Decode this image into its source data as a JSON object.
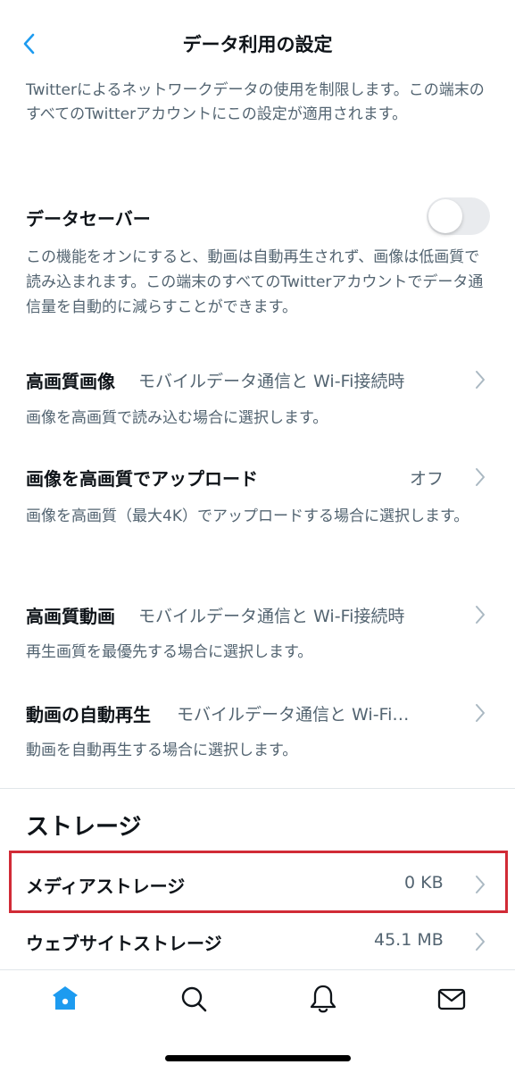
{
  "header": {
    "title": "データ利用の設定",
    "back_icon": "chevron-left-icon"
  },
  "intro": "Twitterによるネットワークデータの使用を制限します。この端末のすべてのTwitterアカウントにこの設定が適用されます。",
  "data_saver": {
    "label": "データセーバー",
    "enabled": false,
    "description": "この機能をオンにすると、動画は自動再生されず、画像は低画質で読み込まれます。この端末のすべてのTwitterアカウントでデータ通信量を自動的に減らすことができます。"
  },
  "settings": [
    {
      "label": "高画質画像",
      "value": "モバイルデータ通信と Wi-Fi接続時",
      "description": "画像を高画質で読み込む場合に選択します。"
    },
    {
      "label": "画像を高画質でアップロード",
      "value": "オフ",
      "description": "画像を高画質（最大4K）でアップロードする場合に選択します。"
    },
    {
      "label": "高画質動画",
      "value": "モバイルデータ通信と Wi-Fi接続時",
      "description": "再生画質を最優先する場合に選択します。"
    },
    {
      "label": "動画の自動再生",
      "value": "モバイルデータ通信と Wi-Fi…",
      "description": "動画を自動再生する場合に選択します。"
    }
  ],
  "storage": {
    "heading": "ストレージ",
    "media": {
      "label": "メディアストレージ",
      "value": "0 KB"
    },
    "web": {
      "label": "ウェブサイトストレージ",
      "value": "45.1 MB"
    }
  },
  "tabbar": [
    "home-icon",
    "search-icon",
    "notifications-icon",
    "messages-icon"
  ],
  "colors": {
    "accent": "#1d9bf0",
    "highlight_border": "#d12b36",
    "secondary_text": "#536471"
  }
}
